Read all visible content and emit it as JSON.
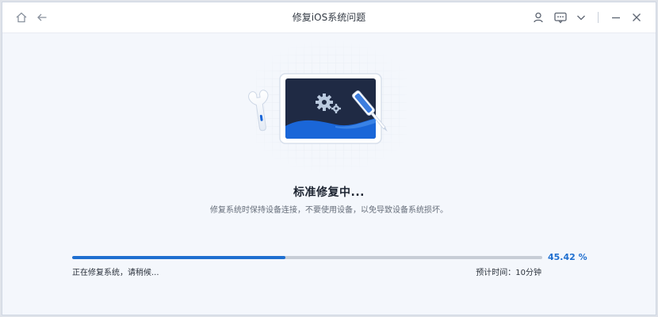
{
  "window": {
    "title": "修复iOS系统问题"
  },
  "titlebar": {
    "left_icons": [
      "home-icon",
      "back-arrow-icon"
    ],
    "right_icons": [
      "user-icon",
      "feedback-icon",
      "chevron-down-icon",
      "minimize-icon",
      "close-icon"
    ]
  },
  "status": {
    "title": "标准修复中...",
    "subtitle": "修复系统时保持设备连接，不要使用设备，以免导致设备系统损坏。"
  },
  "progress": {
    "percent": 45.42,
    "percent_label": "45.42 %",
    "label": "正在修复系统，请稍候...",
    "eta": "预计时间：10分钟"
  },
  "colors": {
    "accent": "#1f6fd0",
    "track": "#c7cdd6",
    "screen": "#1f2a44",
    "wave": "#1a66d8"
  }
}
